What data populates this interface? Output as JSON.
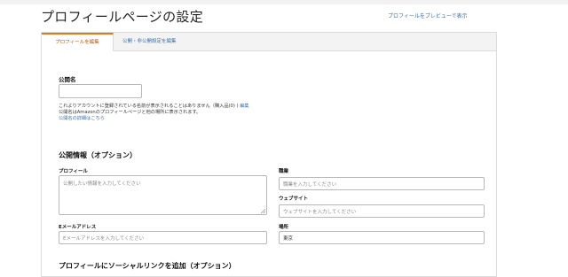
{
  "header": {
    "title": "プロフィールページの設定",
    "preview_link": "プロフィールをプレビューで表示"
  },
  "tabs": [
    {
      "label": "プロフィールを編集",
      "active": true
    },
    {
      "label": "公開・非公開設定を編集",
      "active": false
    }
  ],
  "public_name": {
    "label": "公開名",
    "value": "",
    "note_line1": "これよりアカウントに登録されている名前が表示されることはありません（購入品(0) )",
    "note_line1_link": "編集",
    "note_line2": "公開名はAmazonのプロフィールページと他の場所に表示されます。",
    "help_link": "公開名の詳細はこちら"
  },
  "public_info": {
    "heading": "公開情報（オプション）",
    "profile_label": "プロフィール",
    "profile_placeholder": "公開したい情報を入力してください",
    "occupation_label": "職業",
    "occupation_placeholder": "職業を入力してください",
    "website_label": "ウェブサイト",
    "website_placeholder": "ウェブサイトを入力してください",
    "email_label": "Eメールアドレス",
    "email_placeholder": "Eメールアドレスを入力してください",
    "location_label": "場所",
    "location_value": "東京"
  },
  "social": {
    "heading": "プロフィールにソーシャルリンクを追加（オプション）"
  },
  "colors": {
    "accent_tab": "#e47911",
    "link": "#3a6fa8"
  }
}
